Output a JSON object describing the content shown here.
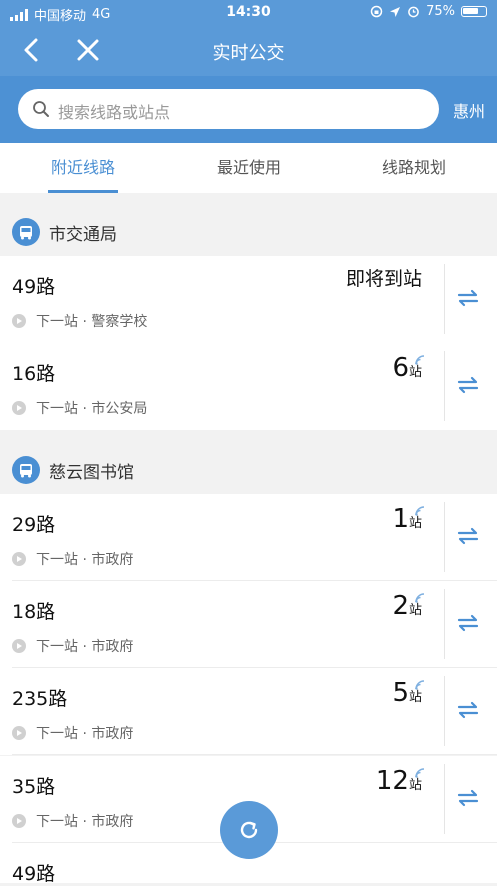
{
  "status_bar": {
    "carrier": "中国移动",
    "network": "4G",
    "time": "14:30",
    "battery": "75%",
    "battery_level": 0.75
  },
  "header": {
    "title": "实时公交"
  },
  "search": {
    "placeholder": "搜索线路或站点",
    "city": "惠州"
  },
  "tabs": [
    {
      "label": "附近线路",
      "active": true
    },
    {
      "label": "最近使用",
      "active": false
    },
    {
      "label": "线路规划",
      "active": false
    }
  ],
  "stations": [
    {
      "name": "市交通局",
      "routes": [
        {
          "line": "49路",
          "arrival_text": "即将到站",
          "next_stop": "下一站 · 警察学校"
        },
        {
          "line": "16路",
          "stops": "6",
          "unit": "站",
          "next_stop": "下一站 · 市公安局"
        }
      ]
    },
    {
      "name": "慈云图书馆",
      "routes": [
        {
          "line": "29路",
          "stops": "1",
          "unit": "站",
          "next_stop": "下一站 · 市政府"
        },
        {
          "line": "18路",
          "stops": "2",
          "unit": "站",
          "next_stop": "下一站 · 市政府"
        },
        {
          "line": "235路",
          "stops": "5",
          "unit": "站",
          "next_stop": "下一站 · 市政府"
        },
        {
          "line": "35路",
          "stops": "12",
          "unit": "站",
          "next_stop": "下一站 · 市政府"
        },
        {
          "line": "49路"
        }
      ]
    }
  ],
  "colors": {
    "primary": "#5a9ad8",
    "accent": "#4a8fd3"
  }
}
